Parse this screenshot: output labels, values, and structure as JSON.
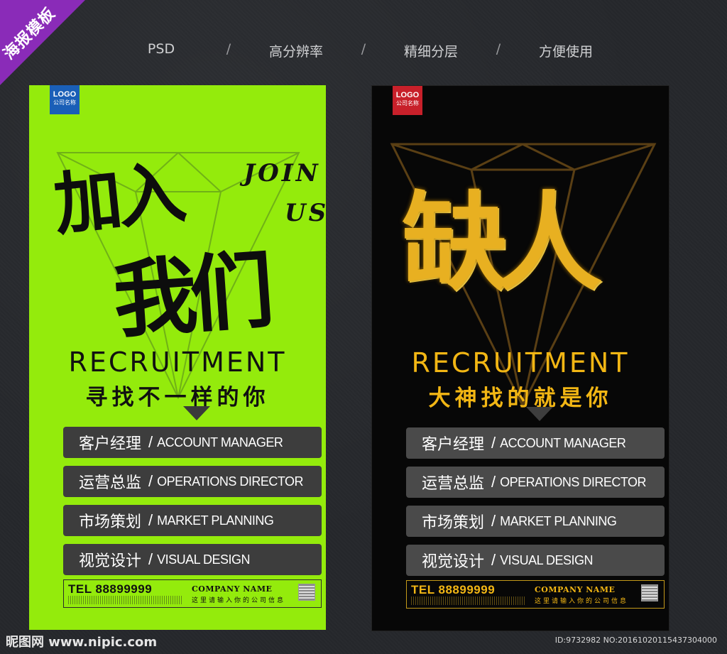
{
  "corner_badge": "海报模板",
  "features": [
    "PSD",
    "高分辨率",
    "精细分层",
    "方便使用"
  ],
  "separator": "/",
  "posters": {
    "green": {
      "logo": "LOGO",
      "logo_sub": "公司名称",
      "title_line1": "加入",
      "title_line2": "我们",
      "join_line1": "JOIN",
      "join_line2": "US",
      "recruit": "RECRUITMENT",
      "slogan": "寻找不一样的你",
      "jobs": [
        {
          "cn": "客户经理",
          "en": "ACCOUNT MANAGER"
        },
        {
          "cn": "运营总监",
          "en": "OPERATIONS DIRECTOR"
        },
        {
          "cn": "市场策划",
          "en": "MARKET PLANNING"
        },
        {
          "cn": "视觉设计",
          "en": "VISUAL DESIGN"
        }
      ],
      "tel": "TEL 88899999",
      "company": "COMPANY NAME",
      "company_sub": "这里请输入你的公司信息"
    },
    "black": {
      "logo": "LOGO",
      "logo_sub": "公司名称",
      "title_line1": "缺人",
      "recruit": "RECRUITMENT",
      "slogan": "大神找的就是你",
      "jobs": [
        {
          "cn": "客户经理",
          "en": "ACCOUNT MANAGER"
        },
        {
          "cn": "运营总监",
          "en": "OPERATIONS DIRECTOR"
        },
        {
          "cn": "市场策划",
          "en": "MARKET PLANNING"
        },
        {
          "cn": "视觉设计",
          "en": "VISUAL DESIGN"
        }
      ],
      "tel": "TEL 88899999",
      "company": "COMPANY NAME",
      "company_sub": "这里请输入你的公司信息"
    }
  },
  "watermark_site": "昵图网 www.nipic.com",
  "watermark_id": "ID:9732982 NO:20161020115437304000",
  "colors": {
    "green_bg": "#94eb0c",
    "black_bg": "#070707",
    "gold": "#f2b614",
    "badge_purple": "#8a2bb8"
  }
}
